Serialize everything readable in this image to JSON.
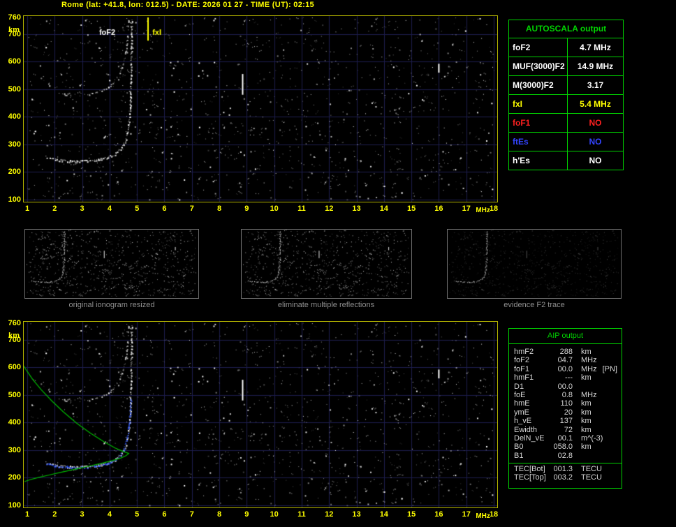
{
  "colors": {
    "background": "#000000",
    "title_yellow": "#ffff00",
    "axis_yellow": "#ffff00",
    "plot_border": "#b4b400",
    "grid": "#1d1d4d",
    "trace_white": "#ffffff",
    "restored_trace_blue": "#2a52ff",
    "profile_green": "#00b800",
    "table_green": "#00d400",
    "caption_gray": "#8f8f8f"
  },
  "header": {
    "title": "Rome (lat: +41.8, lon: 012.5) - DATE: 2026 01 27 - TIME (UT): 02:15"
  },
  "autoscala_table": {
    "title": "AUTOSCALA output",
    "rows": [
      {
        "label": "foF2",
        "value": "4.7 MHz",
        "color": "#ffffff"
      },
      {
        "label": "MUF(3000)F2",
        "value": "14.9 MHz",
        "color": "#ffffff"
      },
      {
        "label": "M(3000)F2",
        "value": "3.17",
        "color": "#ffffff"
      },
      {
        "label": "fxI",
        "value": "5.4 MHz",
        "color": "#ffff00"
      },
      {
        "label": "foF1",
        "value": "NO",
        "color": "#ff2020"
      },
      {
        "label": "ftEs",
        "value": "NO",
        "color": "#3344ff"
      },
      {
        "label": "h'Es",
        "value": "NO",
        "color": "#ffffff"
      }
    ]
  },
  "thumbnails": [
    {
      "caption": "original ionogram resized",
      "noise_alpha": 0.95,
      "show_second_reflection": true
    },
    {
      "caption": "eliminate multiple reflections",
      "noise_alpha": 0.9,
      "show_second_reflection": false
    },
    {
      "caption": "evidence F2 trace",
      "noise_alpha": 0.33,
      "show_second_reflection": false
    }
  ],
  "aip_table": {
    "title": "AIP output",
    "rows": [
      {
        "label": "hmF2",
        "value": "288",
        "unit": "km",
        "note": ""
      },
      {
        "label": "foF2",
        "value": "04.7",
        "unit": "MHz",
        "note": ""
      },
      {
        "label": "foF1",
        "value": "00.0",
        "unit": "MHz",
        "note": "[PN]"
      },
      {
        "label": "hmF1",
        "value": "---",
        "unit": "km",
        "note": ""
      },
      {
        "label": "D1",
        "value": "00.0",
        "unit": "",
        "note": ""
      },
      {
        "label": "foE",
        "value": "0.8",
        "unit": "MHz",
        "note": ""
      },
      {
        "label": "hmE",
        "value": "110",
        "unit": "km",
        "note": ""
      },
      {
        "label": "ymE",
        "value": "20",
        "unit": "km",
        "note": ""
      },
      {
        "label": "h_vE",
        "value": "137",
        "unit": "km",
        "note": ""
      },
      {
        "label": "Ewidth",
        "value": "72",
        "unit": "km",
        "note": ""
      },
      {
        "label": "DelN_vE",
        "value": "00.1",
        "unit": "m^(-3)",
        "note": ""
      },
      {
        "label": "B0",
        "value": "058.0",
        "unit": "km",
        "note": ""
      },
      {
        "label": "B1",
        "value": "02.8",
        "unit": "",
        "note": ""
      }
    ],
    "tec_rows": [
      {
        "label": "TEC[Bot]",
        "value": "001.3",
        "unit": "TECU"
      },
      {
        "label": "TEC[Top]",
        "value": "003.2",
        "unit": "TECU"
      }
    ]
  },
  "chart_data": [
    {
      "name": "autoscaled ionogram (virtual height vs frequency)",
      "type": "scatter",
      "xlabel": "MHz",
      "ylabel": "km",
      "xlim": [
        1,
        18
      ],
      "ylim": [
        100,
        760
      ],
      "x_ticks": [
        1,
        2,
        3,
        4,
        5,
        6,
        7,
        8,
        9,
        10,
        11,
        12,
        13,
        14,
        15,
        16,
        17,
        18
      ],
      "y_ticks": [
        760,
        700,
        600,
        500,
        400,
        300,
        200,
        100
      ],
      "y_gridlines": [
        100,
        200,
        300,
        400,
        500,
        600,
        700
      ],
      "grid": true,
      "legend": "none",
      "scaled_values": {
        "foF2_MHz": 4.7,
        "fxI_MHz": 5.4,
        "MUF3000F2_MHz": 14.9,
        "M3000F2": 3.17
      },
      "noise": {
        "seed": 1337,
        "count": 1300,
        "bright_marks": [
          {
            "f": 8.85,
            "km_top": 555,
            "km_bottom": 480
          },
          {
            "f": 16.0,
            "km_top": 592,
            "km_bottom": 560
          }
        ]
      },
      "series": [
        {
          "name": "F2 ordinary trace",
          "color": "#ffffff",
          "style": "dots",
          "skip": 0.05,
          "alpha": 1,
          "points": [
            [
              1.65,
              255
            ],
            [
              1.8,
              250
            ],
            [
              2.0,
              246
            ],
            [
              2.2,
              243
            ],
            [
              2.4,
              241
            ],
            [
              2.6,
              240
            ],
            [
              2.8,
              240
            ],
            [
              3.0,
              240
            ],
            [
              3.2,
              241
            ],
            [
              3.4,
              243
            ],
            [
              3.6,
              246
            ],
            [
              3.8,
              250
            ],
            [
              4.0,
              256
            ],
            [
              4.15,
              264
            ],
            [
              4.3,
              274
            ],
            [
              4.42,
              287
            ],
            [
              4.52,
              303
            ],
            [
              4.6,
              325
            ],
            [
              4.66,
              352
            ],
            [
              4.7,
              385
            ],
            [
              4.73,
              425
            ],
            [
              4.75,
              470
            ],
            [
              4.765,
              520
            ],
            [
              4.775,
              575
            ],
            [
              4.783,
              635
            ],
            [
              4.789,
              700
            ],
            [
              4.793,
              758
            ]
          ]
        },
        {
          "name": "second reflection",
          "color": "#ffffff",
          "style": "dots",
          "skip": 0.5,
          "alpha": 0.8,
          "points": [
            [
              2.0,
              492
            ],
            [
              2.2,
              486
            ],
            [
              2.4,
              482
            ],
            [
              2.6,
              480
            ],
            [
              2.8,
              480
            ],
            [
              3.0,
              480
            ],
            [
              3.2,
              482
            ],
            [
              3.4,
              486
            ],
            [
              3.6,
              492
            ],
            [
              3.8,
              500
            ],
            [
              4.0,
              512
            ],
            [
              4.15,
              528
            ],
            [
              4.3,
              548
            ],
            [
              4.42,
              574
            ],
            [
              4.52,
              606
            ],
            [
              4.6,
              650
            ],
            [
              4.65,
              704
            ],
            [
              4.68,
              758
            ]
          ]
        }
      ],
      "annotations": [
        {
          "type": "text",
          "text": "foF2",
          "f": 3.62,
          "km": 698,
          "color": "#ffffff"
        },
        {
          "type": "vline",
          "f": 5.4,
          "km_top": 760,
          "km_bottom": 676,
          "color": "#ffff00"
        },
        {
          "type": "text",
          "text": "fxI",
          "f": 5.56,
          "km": 698,
          "color": "#ffff00"
        }
      ]
    },
    {
      "name": "ionogram with restored F2 trace and electron density profile",
      "type": "scatter",
      "xlabel": "MHz",
      "ylabel": "km",
      "xlim": [
        1,
        18
      ],
      "ylim": [
        100,
        760
      ],
      "x_ticks": [
        1,
        2,
        3,
        4,
        5,
        6,
        7,
        8,
        9,
        10,
        11,
        12,
        13,
        14,
        15,
        16,
        17,
        18
      ],
      "y_ticks": [
        760,
        700,
        600,
        500,
        400,
        300,
        200,
        100
      ],
      "y_gridlines": [
        100,
        200,
        300,
        400,
        500,
        600,
        700
      ],
      "grid": true,
      "series_ref": 0,
      "noise": {
        "seed": 1337,
        "count": 1300,
        "bright_marks": [
          {
            "f": 8.85,
            "km_top": 555,
            "km_bottom": 480
          },
          {
            "f": 16.0,
            "km_top": 592,
            "km_bottom": 560
          }
        ]
      },
      "series": [
        {
          "name": "restored F2 trace",
          "color": "#2a52ff",
          "style": "dots",
          "skip": 0.12,
          "alpha": 0.95,
          "points": [
            [
              1.7,
              250
            ],
            [
              2.0,
              245
            ],
            [
              2.4,
              240
            ],
            [
              2.8,
              238
            ],
            [
              3.2,
              239
            ],
            [
              3.6,
              244
            ],
            [
              4.0,
              254
            ],
            [
              4.3,
              272
            ],
            [
              4.5,
              300
            ],
            [
              4.62,
              340
            ],
            [
              4.7,
              390
            ],
            [
              4.74,
              445
            ],
            [
              4.76,
              490
            ]
          ]
        },
        {
          "name": "electron density profile",
          "color": "#00b800",
          "style": "line",
          "points": [
            [
              0.85,
              608
            ],
            [
              1.0,
              585
            ],
            [
              1.2,
              556
            ],
            [
              1.5,
              520
            ],
            [
              1.9,
              478
            ],
            [
              2.3,
              440
            ],
            [
              2.8,
              398
            ],
            [
              3.3,
              362
            ],
            [
              3.8,
              330
            ],
            [
              4.2,
              308
            ],
            [
              4.5,
              295
            ],
            [
              4.65,
              290
            ],
            [
              4.7,
              288
            ],
            [
              4.6,
              280
            ],
            [
              4.4,
              271
            ],
            [
              4.1,
              262
            ],
            [
              3.7,
              252
            ],
            [
              3.2,
              241
            ],
            [
              2.7,
              230
            ],
            [
              2.2,
              219
            ],
            [
              1.8,
              210
            ],
            [
              1.4,
              201
            ],
            [
              1.1,
              193
            ],
            [
              0.9,
              186
            ]
          ]
        }
      ],
      "annotations": []
    }
  ]
}
